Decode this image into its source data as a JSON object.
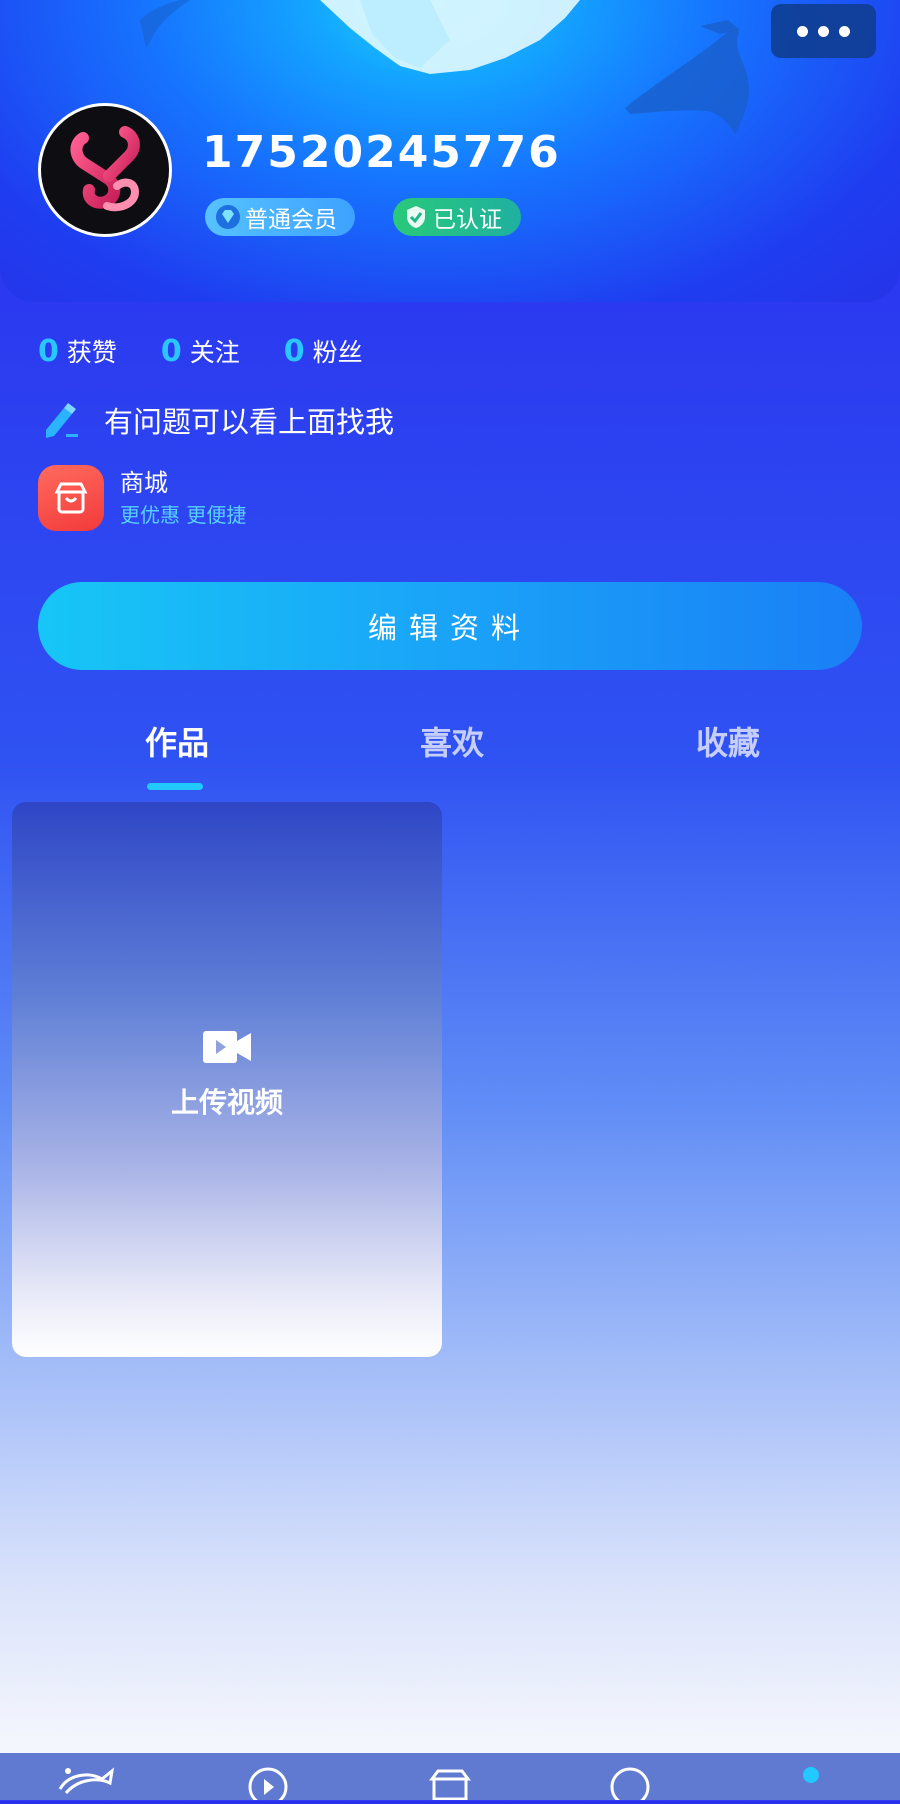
{
  "profile": {
    "username": "17520245776",
    "badges": {
      "member": "普通会员",
      "verified": "已认证"
    }
  },
  "stats": [
    {
      "value": "0",
      "label": "获赞"
    },
    {
      "value": "0",
      "label": "关注"
    },
    {
      "value": "0",
      "label": "粉丝"
    }
  ],
  "bio": "有问题可以看上面找我",
  "shop": {
    "title": "商城",
    "subtitle": "更优惠 更便捷"
  },
  "edit_button_label": "编辑资料",
  "tabs": [
    {
      "label": "作品",
      "active": true
    },
    {
      "label": "喜欢",
      "active": false
    },
    {
      "label": "收藏",
      "active": false
    }
  ],
  "upload": {
    "label": "上传视频",
    "icon": "video-camera-icon"
  },
  "bottom_nav": {
    "icons": [
      "dolphin-icon",
      "play-icon",
      "shop-bag-icon",
      "message-icon",
      "profile-icon"
    ],
    "active_index": 4
  },
  "colors": {
    "accent": "#22c9ff",
    "edit_button": "#1aa7f8",
    "member_badge": "#3da2ff",
    "verified_badge": "#29c97a",
    "shop_icon": "#f23a3a"
  }
}
